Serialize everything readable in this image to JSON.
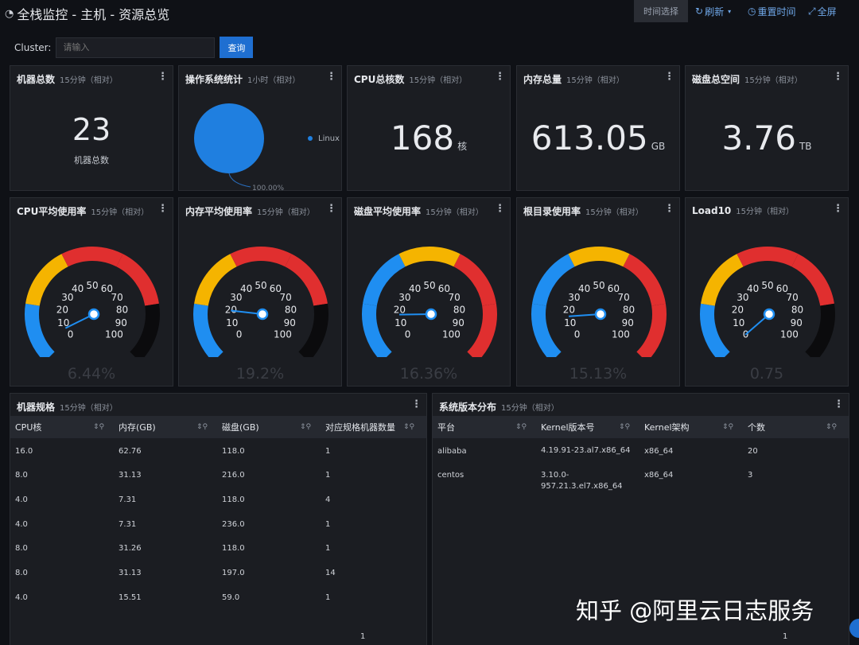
{
  "header": {
    "title": "全栈监控 - 主机 - 资源总览",
    "time_select": "时间选择",
    "refresh": "刷新",
    "reset_time": "重置时间",
    "fullscreen": "全屏"
  },
  "filter": {
    "label": "Cluster:",
    "placeholder": "请输入",
    "query": "查询"
  },
  "panels": {
    "machine_count": {
      "title": "机器总数",
      "range": "15分钟（相对）",
      "value": "23",
      "sub": "机器总数"
    },
    "os_stats": {
      "title": "操作系统统计",
      "range": "1小时（相对）",
      "legend": "Linux",
      "pct": "100.00%"
    },
    "cpu_cores": {
      "title": "CPU总核数",
      "range": "15分钟（相对）",
      "value": "168",
      "unit": "核"
    },
    "mem_total": {
      "title": "内存总量",
      "range": "15分钟（相对）",
      "value": "613.05",
      "unit": "GB"
    },
    "disk_total": {
      "title": "磁盘总空间",
      "range": "15分钟（相对）",
      "value": "3.76",
      "unit": "TB"
    }
  },
  "gauges": [
    {
      "title": "CPU平均使用率",
      "range": "15分钟（相对）",
      "value": 6.44,
      "label": "6.44%",
      "bands": [
        "#1f8ef1",
        "#f5b400",
        "#e02f2f",
        "#e02f2f",
        "#0b0b0d"
      ]
    },
    {
      "title": "内存平均使用率",
      "range": "15分钟（相对）",
      "value": 19.2,
      "label": "19.2%",
      "bands": [
        "#1f8ef1",
        "#f5b400",
        "#e02f2f",
        "#e02f2f",
        "#0b0b0d"
      ]
    },
    {
      "title": "磁盘平均使用率",
      "range": "15分钟（相对）",
      "value": 16.36,
      "label": "16.36%",
      "bands": [
        "#1f8ef1",
        "#1f8ef1",
        "#f5b400",
        "#e02f2f",
        "#e02f2f"
      ]
    },
    {
      "title": "根目录使用率",
      "range": "15分钟（相对）",
      "value": 15.13,
      "label": "15.13%",
      "bands": [
        "#1f8ef1",
        "#1f8ef1",
        "#f5b400",
        "#e02f2f",
        "#e02f2f"
      ]
    },
    {
      "title": "Load10",
      "range": "15分钟（相对）",
      "value": 0.75,
      "label": "0.75",
      "bands": [
        "#1f8ef1",
        "#f5b400",
        "#e02f2f",
        "#e02f2f",
        "#0b0b0d"
      ]
    }
  ],
  "gauge_ticks": [
    "0",
    "10",
    "20",
    "30",
    "40",
    "50",
    "60",
    "70",
    "80",
    "90",
    "100"
  ],
  "spec_table": {
    "title": "机器规格",
    "range": "15分钟（相对）",
    "columns": [
      "CPU核",
      "内存(GB)",
      "磁盘(GB)",
      "对应规格机器数量"
    ],
    "rows": [
      [
        "16.0",
        "62.76",
        "118.0",
        "1"
      ],
      [
        "8.0",
        "31.13",
        "216.0",
        "1"
      ],
      [
        "4.0",
        "7.31",
        "118.0",
        "4"
      ],
      [
        "4.0",
        "7.31",
        "236.0",
        "1"
      ],
      [
        "8.0",
        "31.26",
        "118.0",
        "1"
      ],
      [
        "8.0",
        "31.13",
        "197.0",
        "14"
      ],
      [
        "4.0",
        "15.51",
        "59.0",
        "1"
      ]
    ],
    "page": "1"
  },
  "os_table": {
    "title": "系统版本分布",
    "range": "15分钟（相对）",
    "columns": [
      "平台",
      "Kernel版本号",
      "Kernel架构",
      "个数"
    ],
    "rows": [
      [
        "alibaba",
        "4.19.91-23.al7.x86_64",
        "x86_64",
        "20"
      ],
      [
        "centos",
        "3.10.0-957.21.3.el7.x86_64",
        "x86_64",
        "3"
      ]
    ],
    "page": "1"
  },
  "watermark": "知乎 @阿里云日志服务",
  "colors": {
    "accent": "#1f6fd1",
    "pie": "#1f7fe0"
  }
}
